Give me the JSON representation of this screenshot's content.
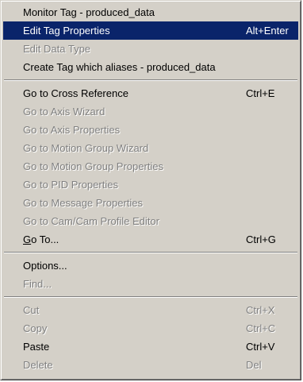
{
  "menu": {
    "groups": [
      [
        {
          "label": "Monitor Tag - produced_data",
          "shortcut": "",
          "state": "enabled"
        },
        {
          "label": "Edit Tag Properties",
          "shortcut": "Alt+Enter",
          "state": "highlighted"
        },
        {
          "label": "Edit Data Type",
          "shortcut": "",
          "state": "disabled"
        },
        {
          "label": "Create Tag which aliases - produced_data",
          "shortcut": "",
          "state": "enabled"
        }
      ],
      [
        {
          "label": "Go to Cross Reference",
          "shortcut": "Ctrl+E",
          "state": "enabled"
        },
        {
          "label": "Go to Axis Wizard",
          "shortcut": "",
          "state": "disabled"
        },
        {
          "label": "Go to Axis Properties",
          "shortcut": "",
          "state": "disabled"
        },
        {
          "label": "Go to Motion Group Wizard",
          "shortcut": "",
          "state": "disabled"
        },
        {
          "label": "Go to Motion Group Properties",
          "shortcut": "",
          "state": "disabled"
        },
        {
          "label": "Go to PID Properties",
          "shortcut": "",
          "state": "disabled"
        },
        {
          "label": "Go to Message Properties",
          "shortcut": "",
          "state": "disabled"
        },
        {
          "label": "Go to Cam/Cam Profile Editor",
          "shortcut": "",
          "state": "disabled"
        },
        {
          "label_mnemonic": "G",
          "label_rest": "o To...",
          "shortcut": "Ctrl+G",
          "state": "enabled"
        }
      ],
      [
        {
          "label": "Options...",
          "shortcut": "",
          "state": "enabled"
        },
        {
          "label": "Find...",
          "shortcut": "",
          "state": "disabled"
        }
      ],
      [
        {
          "label": "Cut",
          "shortcut": "Ctrl+X",
          "state": "disabled"
        },
        {
          "label": "Copy",
          "shortcut": "Ctrl+C",
          "state": "disabled"
        },
        {
          "label": "Paste",
          "shortcut": "Ctrl+V",
          "state": "enabled"
        },
        {
          "label": "Delete",
          "shortcut": "Del",
          "state": "disabled"
        }
      ]
    ],
    "colors": {
      "menu_bg": "#d4d0c8",
      "highlight_bg": "#0a246a",
      "highlight_text": "#ffffff",
      "disabled_text": "#808080"
    }
  }
}
